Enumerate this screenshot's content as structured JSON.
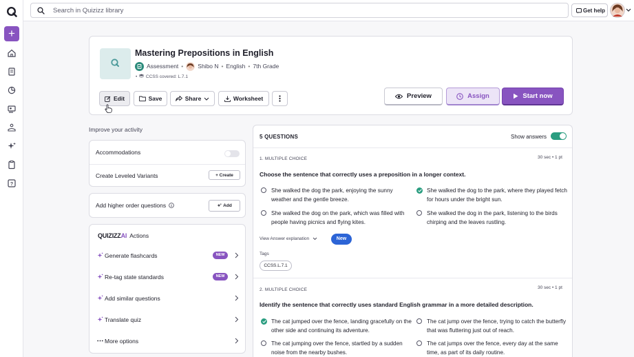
{
  "topbar": {
    "search_placeholder": "Search in Quizizz library",
    "get_help": "Get help"
  },
  "quiz": {
    "title": "Mastering Prepositions in English",
    "type": "Assessment",
    "author": "Shibo N",
    "subject": "English",
    "grade": "7th Grade",
    "ccss": "CCSS covered:  L.7.1"
  },
  "toolbar": {
    "edit": "Edit",
    "save": "Save",
    "share": "Share",
    "worksheet": "Worksheet",
    "preview": "Preview",
    "assign": "Assign",
    "start_now": "Start now"
  },
  "improve": {
    "heading": "Improve your activity",
    "accommodations": "Accommodations",
    "leveled_variants": "Create Leveled Variants",
    "create": "+ Create",
    "higher_order": "Add higher order questions",
    "add": "Add"
  },
  "actions": {
    "brand": "QUIZIZZ",
    "brand_ai": "AI",
    "title": "Actions",
    "items": [
      {
        "label": "Generate flashcards",
        "badge": "NEW"
      },
      {
        "label": "Re-tag state standards",
        "badge": "NEW"
      },
      {
        "label": "Add similar questions",
        "badge": ""
      },
      {
        "label": "Translate quiz",
        "badge": ""
      },
      {
        "label": "More options",
        "badge": ""
      }
    ]
  },
  "questions": {
    "count_label": "5 QUESTIONS",
    "show_answers": "Show answers",
    "items": [
      {
        "type": "1. MULTIPLE CHOICE",
        "time": "30 sec  •  1 pt",
        "text": "Choose the sentence that correctly uses a preposition in a longer context.",
        "options": [
          {
            "text": "She walked the dog the park, enjoying the sunny weather and the gentle breeze.",
            "correct": false
          },
          {
            "text": "She walked the dog to the park, where they played fetch for hours under the bright sun.",
            "correct": true
          },
          {
            "text": "She walked the dog on the park, which was filled with people having picnics and flying kites.",
            "correct": false
          },
          {
            "text": "She walked the dog in the park, listening to the birds chirping and the leaves rustling.",
            "correct": false
          }
        ],
        "view_explanation": "View Answer explanation",
        "new_badge": "New",
        "tags_label": "Tags",
        "tag": "CCSS.L.7.1"
      },
      {
        "type": "2. MULTIPLE CHOICE",
        "time": "30 sec  •  1 pt",
        "text": "Identify the sentence that correctly uses standard English grammar in a more detailed description.",
        "options": [
          {
            "text": "The cat jumped over the fence, landing gracefully on the other side and continuing its adventure.",
            "correct": true
          },
          {
            "text": "The cat jump over the fence, trying to catch the butterfly that was fluttering just out of reach.",
            "correct": false
          },
          {
            "text": "The cat jumping over the fence, startled by a sudden noise from the nearby bushes.",
            "correct": false
          },
          {
            "text": "The cat jumps over the fence, every day at the same time, as part of its daily routine.",
            "correct": false
          }
        ]
      }
    ]
  },
  "colors": {
    "brand_purple": "#8854c0",
    "correct_green": "#2a9d80",
    "new_blue": "#2c64d6"
  }
}
